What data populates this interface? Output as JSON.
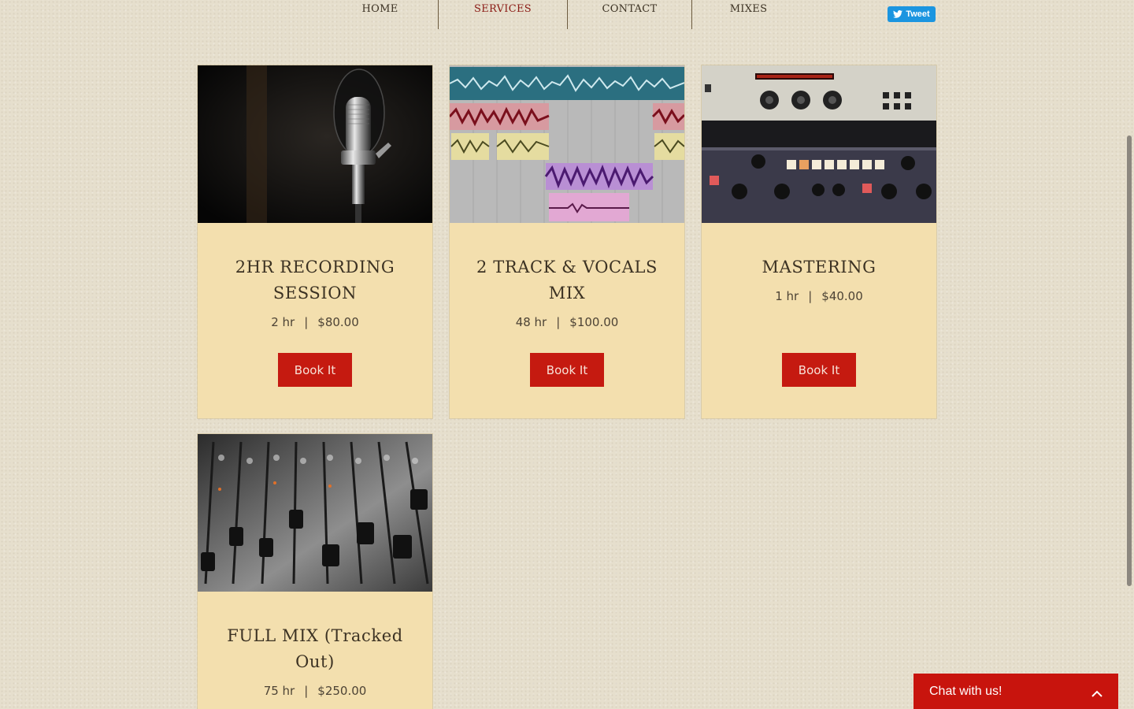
{
  "nav": {
    "items": [
      {
        "label": "HOME",
        "active": false
      },
      {
        "label": "SERVICES",
        "active": true
      },
      {
        "label": "CONTACT",
        "active": false
      },
      {
        "label": "MIXES",
        "active": false
      }
    ],
    "tweet_label": "Tweet"
  },
  "services": [
    {
      "title": "2HR RECORDING SESSION",
      "duration": "2 hr",
      "separator": "|",
      "price": "$80.00",
      "button": "Book It",
      "image": "studio-microphone"
    },
    {
      "title": "2 TRACK & VOCALS MIX",
      "duration": "48 hr",
      "separator": "|",
      "price": "$100.00",
      "button": "Book It",
      "image": "daw-waveform-tracks"
    },
    {
      "title": "MASTERING",
      "duration": "1 hr",
      "separator": "|",
      "price": "$40.00",
      "button": "Book It",
      "image": "mastering-rack-units"
    },
    {
      "title": "FULL MIX (Tracked Out)",
      "duration": "75 hr",
      "separator": "|",
      "price": "$250.00",
      "button": "Book It",
      "image": "mixing-console-faders"
    }
  ],
  "chat": {
    "label": "Chat with us!"
  },
  "colors": {
    "background": "#e6dfcd",
    "card": "#f3dfae",
    "button": "#c51a10",
    "nav_active": "#8a1a14",
    "chat": "#c8140d",
    "tweet": "#1b95e0"
  }
}
